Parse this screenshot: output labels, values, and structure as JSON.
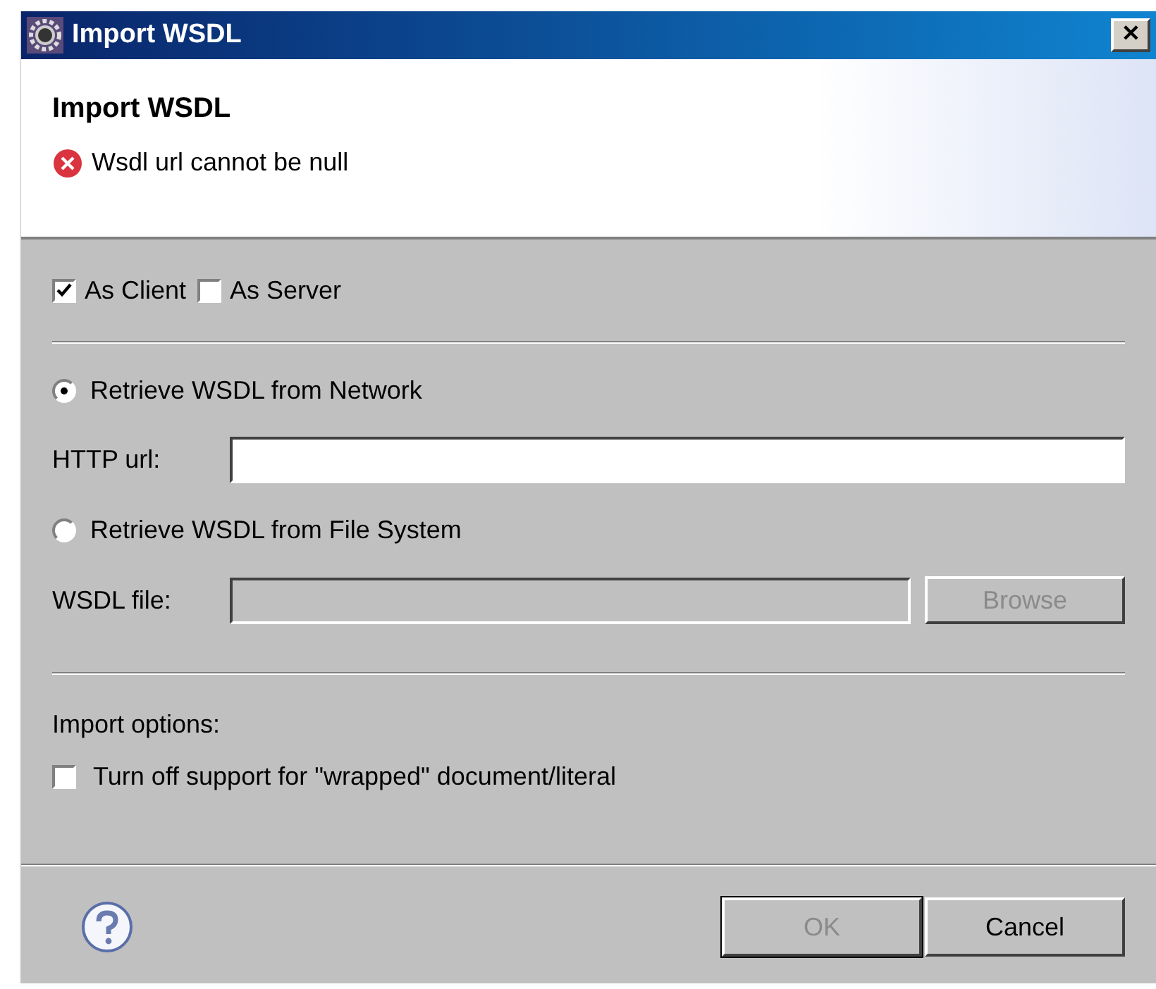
{
  "window": {
    "title": "Import WSDL",
    "close": "✕"
  },
  "header": {
    "title": "Import WSDL",
    "message": "Wsdl url cannot be null"
  },
  "roles": [
    {
      "label": "As Client",
      "checked": true
    },
    {
      "label": "As Server",
      "checked": false
    }
  ],
  "sources": [
    {
      "label": "Retrieve WSDL from Network",
      "selected": true,
      "field_label": "HTTP url:",
      "field_disabled": false
    },
    {
      "label": "Retrieve WSDL from File System",
      "selected": false,
      "field_label": "WSDL file:",
      "field_disabled": true,
      "button": "Browse",
      "button_disabled": true
    }
  ],
  "import_options": {
    "label": "Import options:",
    "options": [
      {
        "label": "Turn off support for \"wrapped\" document/literal",
        "checked": false
      }
    ]
  },
  "buttons": [
    {
      "label": "OK",
      "disabled": true
    },
    {
      "label": "Cancel",
      "disabled": false
    }
  ]
}
